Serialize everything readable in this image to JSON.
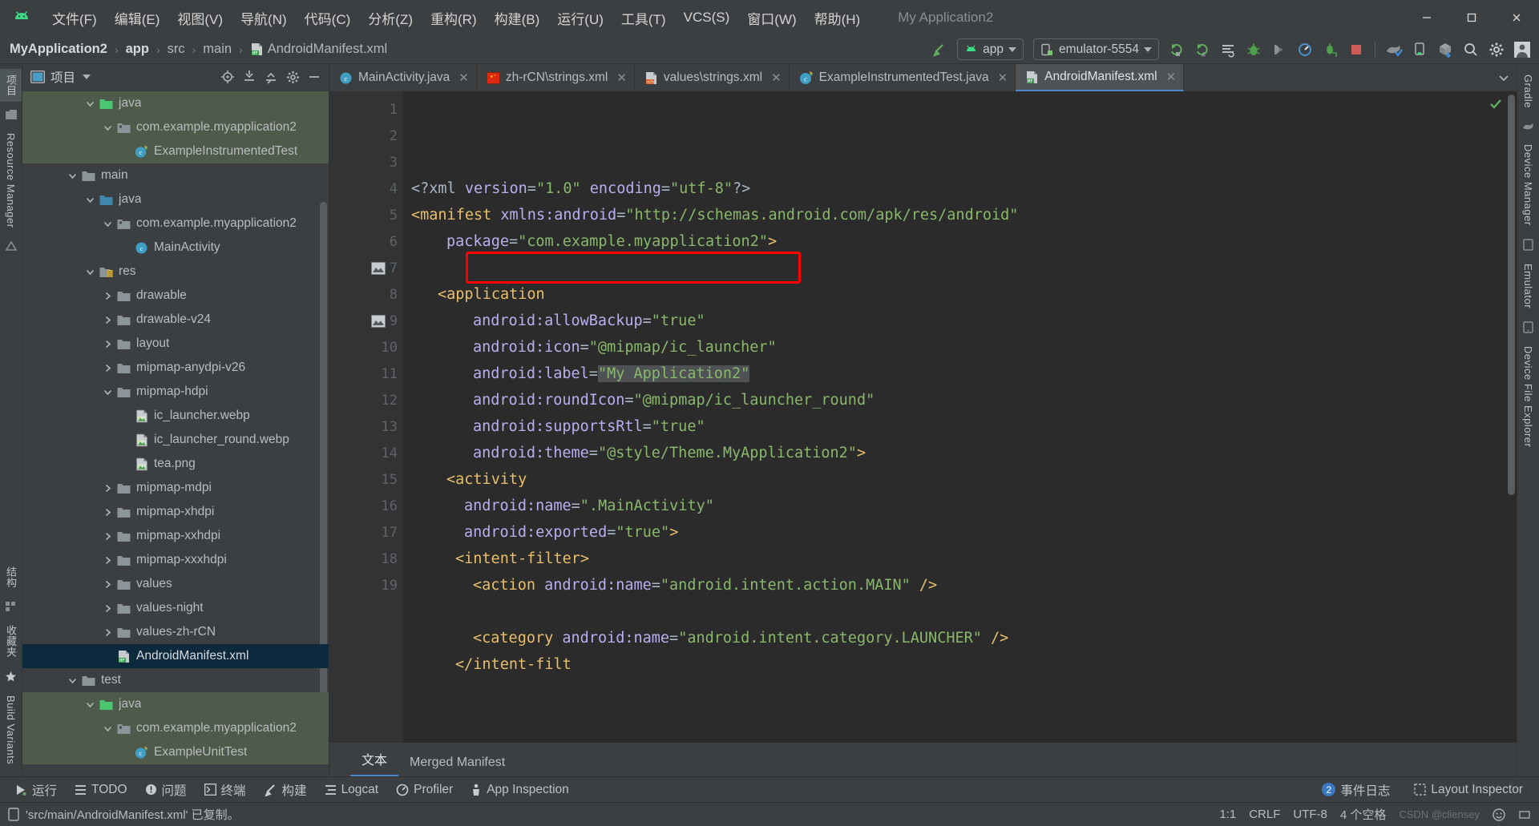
{
  "window": {
    "app_title": "My Application2",
    "minimize": "–",
    "maximize": "❐",
    "close": "✕"
  },
  "menubar": {
    "items": [
      {
        "label": "文件(F)",
        "name": "menu-file"
      },
      {
        "label": "编辑(E)",
        "name": "menu-edit"
      },
      {
        "label": "视图(V)",
        "name": "menu-view"
      },
      {
        "label": "导航(N)",
        "name": "menu-navigate"
      },
      {
        "label": "代码(C)",
        "name": "menu-code"
      },
      {
        "label": "分析(Z)",
        "name": "menu-analyze"
      },
      {
        "label": "重构(R)",
        "name": "menu-refactor"
      },
      {
        "label": "构建(B)",
        "name": "menu-build"
      },
      {
        "label": "运行(U)",
        "name": "menu-run"
      },
      {
        "label": "工具(T)",
        "name": "menu-tools"
      },
      {
        "label": "VCS(S)",
        "name": "menu-vcs"
      },
      {
        "label": "窗口(W)",
        "name": "menu-window"
      },
      {
        "label": "帮助(H)",
        "name": "menu-help"
      }
    ]
  },
  "navbar": {
    "breadcrumbs": [
      {
        "label": "MyApplication2",
        "bold": true
      },
      {
        "label": "app",
        "bold": true
      },
      {
        "label": "src",
        "bold": false
      },
      {
        "label": "main",
        "bold": false
      },
      {
        "label": "AndroidManifest.xml",
        "bold": false,
        "icon": "manifest-file-icon"
      }
    ],
    "separator": "›",
    "module_selector": "app",
    "device_selector": "emulator-5554",
    "toolbar_icons": [
      "make-project-icon",
      "run-icon",
      "run-with-coverage-icon",
      "apply-changes-icon",
      "debug-icon",
      "profile-icon",
      "attach-debugger-icon",
      "stop-icon",
      "gradle-sync-icon",
      "avd-manager-icon",
      "sdk-manager-icon",
      "search-icon",
      "settings-icon",
      "account-icon"
    ]
  },
  "left_strip": {
    "top_tabs": [
      {
        "label": "项目",
        "name": "tool-window-project",
        "active": true
      }
    ],
    "tabs": [
      {
        "label": "Resource Manager",
        "name": "tool-window-resource-manager"
      },
      {
        "label": "结构",
        "name": "tool-window-structure"
      },
      {
        "label": "收藏夹",
        "name": "tool-window-favorites"
      },
      {
        "label": "Build Variants",
        "name": "tool-window-build-variants"
      }
    ]
  },
  "right_strip": {
    "tabs": [
      {
        "label": "Gradle",
        "name": "tool-window-gradle"
      },
      {
        "label": "Device Manager",
        "name": "tool-window-device-manager"
      },
      {
        "label": "Emulator",
        "name": "tool-window-emulator"
      },
      {
        "label": "Device File Explorer",
        "name": "tool-window-device-file-explorer"
      }
    ]
  },
  "project_panel": {
    "title": "项目",
    "header_icons": [
      "select-opened-file-icon",
      "expand-all-icon",
      "collapse-all-icon",
      "settings-icon",
      "hide-icon"
    ],
    "tree": [
      {
        "label": "java",
        "depth": 3,
        "arrow": "down",
        "icon": "folder-green",
        "row": "green"
      },
      {
        "label": "com.example.myapplication2",
        "depth": 4,
        "arrow": "down",
        "icon": "package",
        "row": "green"
      },
      {
        "label": "ExampleInstrumentedTest",
        "depth": 5,
        "arrow": "none",
        "icon": "class-test",
        "row": "green"
      },
      {
        "label": "main",
        "depth": 2,
        "arrow": "down",
        "icon": "folder",
        "row": "none"
      },
      {
        "label": "java",
        "depth": 3,
        "arrow": "down",
        "icon": "folder-blue",
        "row": "none"
      },
      {
        "label": "com.example.myapplication2",
        "depth": 4,
        "arrow": "down",
        "icon": "package",
        "row": "none"
      },
      {
        "label": "MainActivity",
        "depth": 5,
        "arrow": "none",
        "icon": "class",
        "row": "none"
      },
      {
        "label": "res",
        "depth": 3,
        "arrow": "down",
        "icon": "folder-res",
        "row": "none"
      },
      {
        "label": "drawable",
        "depth": 4,
        "arrow": "right",
        "icon": "folder",
        "row": "none"
      },
      {
        "label": "drawable-v24",
        "depth": 4,
        "arrow": "right",
        "icon": "folder",
        "row": "none"
      },
      {
        "label": "layout",
        "depth": 4,
        "arrow": "right",
        "icon": "folder",
        "row": "none"
      },
      {
        "label": "mipmap-anydpi-v26",
        "depth": 4,
        "arrow": "right",
        "icon": "folder",
        "row": "none"
      },
      {
        "label": "mipmap-hdpi",
        "depth": 4,
        "arrow": "down",
        "icon": "folder",
        "row": "none"
      },
      {
        "label": "ic_launcher.webp",
        "depth": 5,
        "arrow": "none",
        "icon": "image",
        "row": "none"
      },
      {
        "label": "ic_launcher_round.webp",
        "depth": 5,
        "arrow": "none",
        "icon": "image",
        "row": "none"
      },
      {
        "label": "tea.png",
        "depth": 5,
        "arrow": "none",
        "icon": "image",
        "row": "none"
      },
      {
        "label": "mipmap-mdpi",
        "depth": 4,
        "arrow": "right",
        "icon": "folder",
        "row": "none"
      },
      {
        "label": "mipmap-xhdpi",
        "depth": 4,
        "arrow": "right",
        "icon": "folder",
        "row": "none"
      },
      {
        "label": "mipmap-xxhdpi",
        "depth": 4,
        "arrow": "right",
        "icon": "folder",
        "row": "none"
      },
      {
        "label": "mipmap-xxxhdpi",
        "depth": 4,
        "arrow": "right",
        "icon": "folder",
        "row": "none"
      },
      {
        "label": "values",
        "depth": 4,
        "arrow": "right",
        "icon": "folder",
        "row": "none"
      },
      {
        "label": "values-night",
        "depth": 4,
        "arrow": "right",
        "icon": "folder",
        "row": "none"
      },
      {
        "label": "values-zh-rCN",
        "depth": 4,
        "arrow": "right",
        "icon": "folder",
        "row": "none"
      },
      {
        "label": "AndroidManifest.xml",
        "depth": 4,
        "arrow": "none",
        "icon": "manifest",
        "row": "sel"
      },
      {
        "label": "test",
        "depth": 2,
        "arrow": "down",
        "icon": "folder",
        "row": "none"
      },
      {
        "label": "java",
        "depth": 3,
        "arrow": "down",
        "icon": "folder-green",
        "row": "green"
      },
      {
        "label": "com.example.myapplication2",
        "depth": 4,
        "arrow": "down",
        "icon": "package",
        "row": "green"
      },
      {
        "label": "ExampleUnitTest",
        "depth": 5,
        "arrow": "none",
        "icon": "class-test",
        "row": "green"
      }
    ]
  },
  "editor_tabs": [
    {
      "label": "MainActivity.java",
      "icon": "java-class-icon",
      "active": false,
      "close": "✕"
    },
    {
      "label": "zh-rCN\\strings.xml",
      "icon": "china-flag-icon",
      "active": false,
      "close": "✕"
    },
    {
      "label": "values\\strings.xml",
      "icon": "xml-values-icon",
      "active": false,
      "close": "✕"
    },
    {
      "label": "ExampleInstrumentedTest.java",
      "icon": "java-test-icon",
      "active": false,
      "close": "✕"
    },
    {
      "label": "AndroidManifest.xml",
      "icon": "manifest-file-icon",
      "active": true,
      "close": "✕"
    }
  ],
  "editor": {
    "line_numbers": [
      "1",
      "2",
      "3",
      "4",
      "5",
      "6",
      "7",
      "8",
      "9",
      "10",
      "11",
      "12",
      "13",
      "14",
      "15",
      "16",
      "17",
      "18",
      "19"
    ],
    "code_lines": [
      {
        "n": 1,
        "tokens": [
          {
            "t": "<?xml ",
            "c": "plain"
          },
          {
            "t": "version",
            "c": "attr"
          },
          {
            "t": "=",
            "c": "eq"
          },
          {
            "t": "\"1.0\"",
            "c": "val"
          },
          {
            "t": " ",
            "c": "plain"
          },
          {
            "t": "encoding",
            "c": "attr"
          },
          {
            "t": "=",
            "c": "eq"
          },
          {
            "t": "\"utf-8\"",
            "c": "val"
          },
          {
            "t": "?>",
            "c": "plain"
          }
        ],
        "indent": 0
      },
      {
        "n": 2,
        "tokens": [
          {
            "t": "<manifest ",
            "c": "tag"
          },
          {
            "t": "xmlns:android",
            "c": "attr"
          },
          {
            "t": "=",
            "c": "eq"
          },
          {
            "t": "\"http://schemas.android.com/apk/res/android\"",
            "c": "val"
          }
        ],
        "indent": 0
      },
      {
        "n": 3,
        "tokens": [
          {
            "t": "package",
            "c": "attr"
          },
          {
            "t": "=",
            "c": "eq"
          },
          {
            "t": "\"com.example.myapplication2\"",
            "c": "val"
          },
          {
            "t": ">",
            "c": "tag"
          }
        ],
        "indent": 4
      },
      {
        "n": 4,
        "tokens": [],
        "indent": 0
      },
      {
        "n": 5,
        "tokens": [
          {
            "t": "<application",
            "c": "tag"
          }
        ],
        "indent": 3
      },
      {
        "n": 6,
        "tokens": [
          {
            "t": "android:allowBackup",
            "c": "attr"
          },
          {
            "t": "=",
            "c": "eq"
          },
          {
            "t": "\"true\"",
            "c": "val"
          }
        ],
        "indent": 7
      },
      {
        "n": 7,
        "tokens": [
          {
            "t": "android:icon",
            "c": "attr"
          },
          {
            "t": "=",
            "c": "eq"
          },
          {
            "t": "\"@mipmap/ic_launcher\"",
            "c": "val"
          }
        ],
        "indent": 7
      },
      {
        "n": 8,
        "tokens": [
          {
            "t": "android:label",
            "c": "attr"
          },
          {
            "t": "=",
            "c": "eq"
          },
          {
            "t": "\"My Application2\"",
            "c": "val-sel"
          }
        ],
        "indent": 7
      },
      {
        "n": 9,
        "tokens": [
          {
            "t": "android:roundIcon",
            "c": "attr"
          },
          {
            "t": "=",
            "c": "eq"
          },
          {
            "t": "\"@mipmap/ic_launcher_round\"",
            "c": "val"
          }
        ],
        "indent": 7
      },
      {
        "n": 10,
        "tokens": [
          {
            "t": "android:supportsRtl",
            "c": "attr"
          },
          {
            "t": "=",
            "c": "eq"
          },
          {
            "t": "\"true\"",
            "c": "val"
          }
        ],
        "indent": 7
      },
      {
        "n": 11,
        "tokens": [
          {
            "t": "android:theme",
            "c": "attr"
          },
          {
            "t": "=",
            "c": "eq"
          },
          {
            "t": "\"@style/Theme.MyApplication2\"",
            "c": "val"
          },
          {
            "t": ">",
            "c": "tag"
          }
        ],
        "indent": 7
      },
      {
        "n": 12,
        "tokens": [
          {
            "t": "<activity",
            "c": "tag"
          }
        ],
        "indent": 4
      },
      {
        "n": 13,
        "tokens": [
          {
            "t": "android:name",
            "c": "attr"
          },
          {
            "t": "=",
            "c": "eq"
          },
          {
            "t": "\".MainActivity\"",
            "c": "val"
          }
        ],
        "indent": 6
      },
      {
        "n": 14,
        "tokens": [
          {
            "t": "android:exported",
            "c": "attr"
          },
          {
            "t": "=",
            "c": "eq"
          },
          {
            "t": "\"true\"",
            "c": "val"
          },
          {
            "t": ">",
            "c": "tag"
          }
        ],
        "indent": 6
      },
      {
        "n": 15,
        "tokens": [
          {
            "t": "<intent-filter>",
            "c": "tag"
          }
        ],
        "indent": 5
      },
      {
        "n": 16,
        "tokens": [
          {
            "t": "<action ",
            "c": "tag"
          },
          {
            "t": "android:name",
            "c": "attr"
          },
          {
            "t": "=",
            "c": "eq"
          },
          {
            "t": "\"android.intent.action.MAIN\"",
            "c": "val"
          },
          {
            "t": " />",
            "c": "tag"
          }
        ],
        "indent": 7
      },
      {
        "n": 17,
        "tokens": [],
        "indent": 0
      },
      {
        "n": 18,
        "tokens": [
          {
            "t": "<category ",
            "c": "tag"
          },
          {
            "t": "android:name",
            "c": "attr"
          },
          {
            "t": "=",
            "c": "eq"
          },
          {
            "t": "\"android.intent.category.LAUNCHER\"",
            "c": "val"
          },
          {
            "t": " />",
            "c": "tag"
          }
        ],
        "indent": 7
      },
      {
        "n": 19,
        "tokens": [
          {
            "t": "</intent-filt",
            "c": "tag"
          }
        ],
        "indent": 5
      }
    ],
    "highlight_annotation": {
      "line": 7,
      "color": "#ff0000",
      "label": "red-rectangle-annotation"
    },
    "gutter_image_lines": [
      7,
      9
    ],
    "fold_lines": [
      2,
      5,
      12,
      15
    ],
    "bottom_tabs": [
      {
        "label": "文本",
        "active": true
      },
      {
        "label": "Merged Manifest",
        "active": false
      }
    ]
  },
  "bottom_toolwindows": [
    {
      "label": "运行",
      "icon": "run-icon",
      "name": "toolwindow-run"
    },
    {
      "label": "TODO",
      "icon": "todo-icon",
      "name": "toolwindow-todo"
    },
    {
      "label": "问题",
      "icon": "problems-icon",
      "name": "toolwindow-problems"
    },
    {
      "label": "终端",
      "icon": "terminal-icon",
      "name": "toolwindow-terminal"
    },
    {
      "label": "构建",
      "icon": "build-icon",
      "name": "toolwindow-build"
    },
    {
      "label": "Logcat",
      "icon": "logcat-icon",
      "name": "toolwindow-logcat"
    },
    {
      "label": "Profiler",
      "icon": "profiler-icon",
      "name": "toolwindow-profiler"
    },
    {
      "label": "App Inspection",
      "icon": "app-inspection-icon",
      "name": "toolwindow-app-inspection"
    }
  ],
  "bottom_right": {
    "event_log_count": "2",
    "event_log": "事件日志",
    "layout_inspector": "Layout Inspector"
  },
  "statusbar": {
    "message": "'src/main/AndroidManifest.xml' 已复制。",
    "caret_position": "1:1",
    "line_separator": "CRLF",
    "encoding": "UTF-8",
    "indent": "4 个空格",
    "watermark": "CSDN @cliensey"
  }
}
